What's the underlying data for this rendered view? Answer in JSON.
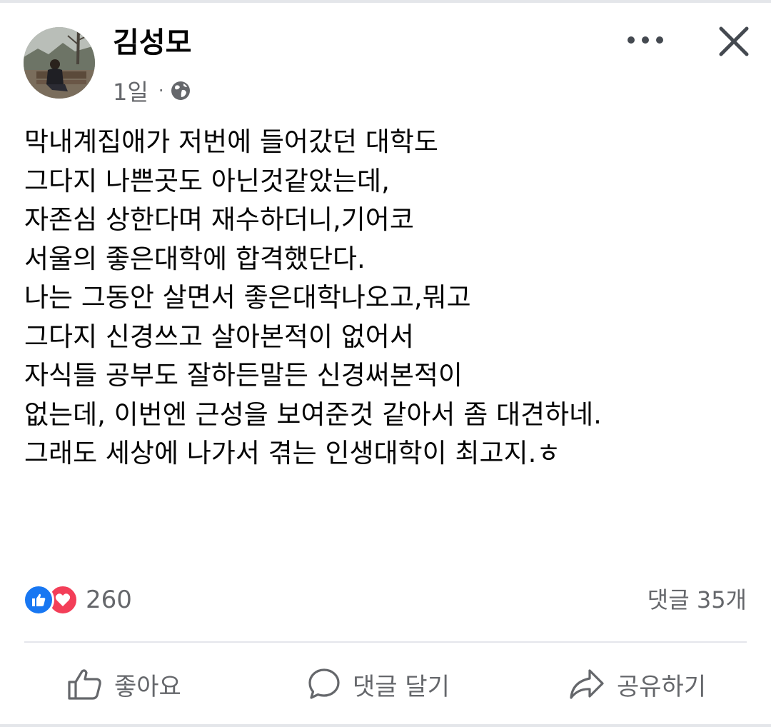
{
  "post": {
    "author": "김성모",
    "time": "1일",
    "separator": "·",
    "privacy_icon": "globe-icon",
    "menu_icon": "more-dots-icon",
    "close_icon": "close-icon",
    "lines": [
      "막내계집애가 저번에 들어갔던 대학도",
      "그다지 나쁜곳도 아닌것같았는데,",
      "자존심 상한다며 재수하더니,기어코",
      "서울의 좋은대학에 합격했단다.",
      "나는 그동안 살면서 좋은대학나오고,뭐고",
      "그다지 신경쓰고 살아본적이 없어서",
      "자식들 공부도 잘하든말든 신경써본적이",
      "없는데, 이번엔 근성을 보여준것 같아서 좀 대견하네.",
      "그래도 세상에 나가서 겪는 인생대학이 최고지.ㅎ"
    ]
  },
  "stats": {
    "reaction_icons": [
      "like-reaction-icon",
      "love-reaction-icon"
    ],
    "reaction_count": "260",
    "comments_label": "댓글 35개"
  },
  "actions": {
    "like": "좋아요",
    "comment": "댓글 달기",
    "share": "공유하기"
  },
  "colors": {
    "text": "#050505",
    "secondary": "#65676b",
    "like_blue": "#1877f2",
    "love_red": "#f33e58",
    "divider": "#e4e6eb"
  }
}
